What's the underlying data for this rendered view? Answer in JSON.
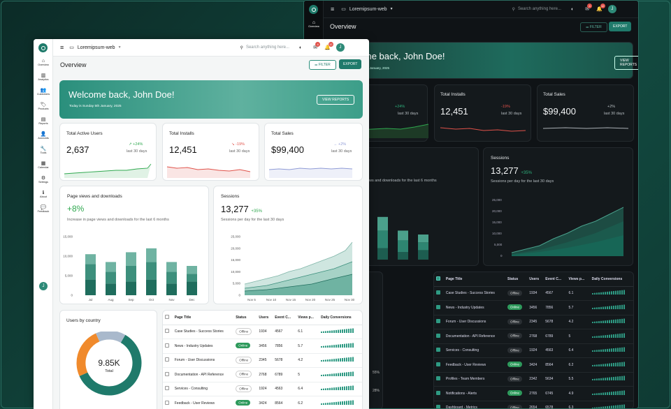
{
  "app": {
    "site": "Loremipsum-web",
    "search_placeholder": "Search anything here...",
    "page_title": "Overview",
    "filter_label": "FILTER",
    "export_label": "EXPORT",
    "avatar_initial": "J",
    "mail_count": "4",
    "notif_count": "12"
  },
  "nav": [
    "Overview",
    "Analytics",
    "Customers",
    "Products",
    "Reports",
    "Accounts",
    "Tools",
    "Calendar",
    "Settings",
    "About",
    "Feedback"
  ],
  "welcome": {
    "title": "Welcome back, John Doe!",
    "date": "Today is Sunday 5th January, 2025",
    "button": "VIEW REPORTS"
  },
  "kpis": [
    {
      "title": "Total Active Users",
      "value": "2,637",
      "change": "+24%",
      "period": "last 30 days",
      "trend": "up",
      "color": "#2fa84f"
    },
    {
      "title": "Total Installs",
      "value": "12,451",
      "change": "-19%",
      "period": "last 30 days",
      "trend": "down",
      "color": "#e0524a"
    },
    {
      "title": "Total Sales",
      "value": "$99,400",
      "change": "+2%",
      "period": "last 30 days",
      "trend": "flat",
      "color": "#8f9bd6"
    }
  ],
  "pageviews": {
    "title": "Page views and downloads",
    "value": "+8%",
    "desc": "Increase in page views and downloads for the last 6 months"
  },
  "sessions": {
    "title": "Sessions",
    "value": "13,277",
    "change": "+35%",
    "desc": "Sessions per day for the last 30 days"
  },
  "users_country": {
    "title": "Users by country",
    "value": "9.85K",
    "label": "Total"
  },
  "dark_percent": [
    "55%",
    "28%"
  ],
  "table": {
    "headers": [
      "Page Title",
      "Status",
      "Users",
      "Event C...",
      "Views p...",
      "Daily Conversions"
    ],
    "rows": [
      [
        "Case Studies - Success Stories",
        "Offline",
        "1934",
        "4567",
        "6.1"
      ],
      [
        "News - Industry Updates",
        "Online",
        "3456",
        "7856",
        "5.7"
      ],
      [
        "Forum - User Discussions",
        "Offline",
        "2345",
        "5678",
        "4.2"
      ],
      [
        "Documentation - API Reference",
        "Offline",
        "2768",
        "6789",
        "5"
      ],
      [
        "Services - Consulting",
        "Offline",
        "1924",
        "4563",
        "6.4"
      ],
      [
        "Feedback - User Reviews",
        "Online",
        "3424",
        "8564",
        "6.2"
      ],
      [
        "Profiles - Team Members",
        "Offline",
        "2342",
        "5634",
        "5.5"
      ],
      [
        "Notifications - Alerts",
        "Online",
        "2765",
        "6745",
        "4.9"
      ],
      [
        "Dashboard - Metrics",
        "Offline",
        "2654",
        "6578",
        "6.3"
      ]
    ]
  },
  "chart_data": [
    {
      "type": "bar",
      "title": "Page views and downloads",
      "categories": [
        "Jul",
        "Aug",
        "Sep",
        "Oct",
        "Nov",
        "Dec"
      ],
      "series": [
        {
          "values": [
            4000,
            3000,
            3500,
            4000,
            3000,
            3500
          ]
        },
        {
          "values": [
            4000,
            3000,
            4000,
            4500,
            3000,
            2000
          ]
        },
        {
          "values": [
            2500,
            2500,
            3500,
            3500,
            2500,
            2000
          ]
        }
      ],
      "ylim": [
        0,
        15000
      ],
      "yticks": [
        "0",
        "5,000",
        "10,000",
        "15,000"
      ]
    },
    {
      "type": "area",
      "title": "Sessions",
      "categories": [
        "Nov 5",
        "Nov 10",
        "Nov 15",
        "Nov 20",
        "Nov 25",
        "Nov 30"
      ],
      "ylim": [
        0,
        25000
      ],
      "yticks": [
        "0",
        "5,000",
        "10,000",
        "15,000",
        "20,000",
        "25,000"
      ]
    },
    {
      "type": "pie",
      "title": "Users by country",
      "values": [
        60,
        25,
        15
      ],
      "colors": [
        "#1f7a6b",
        "#f08a2c",
        "#a9b9cc"
      ]
    }
  ],
  "colors": {
    "accent": "#1f7a6b",
    "dark_bg": "#0f1316",
    "light_bg": "#f4f6f6"
  }
}
